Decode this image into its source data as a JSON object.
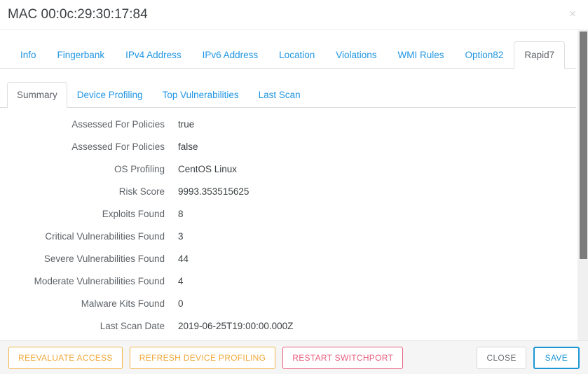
{
  "header": {
    "title": "MAC 00:0c:29:30:17:84",
    "close_icon": "close-icon",
    "close_glyph": "×"
  },
  "tabs_main": [
    {
      "label": "Info",
      "active": false
    },
    {
      "label": "Fingerbank",
      "active": false
    },
    {
      "label": "IPv4 Address",
      "active": false
    },
    {
      "label": "IPv6 Address",
      "active": false
    },
    {
      "label": "Location",
      "active": false
    },
    {
      "label": "Violations",
      "active": false
    },
    {
      "label": "WMI Rules",
      "active": false
    },
    {
      "label": "Option82",
      "active": false
    },
    {
      "label": "Rapid7",
      "active": true
    }
  ],
  "tabs_sub": [
    {
      "label": "Summary",
      "active": true
    },
    {
      "label": "Device Profiling",
      "active": false
    },
    {
      "label": "Top Vulnerabilities",
      "active": false
    },
    {
      "label": "Last Scan",
      "active": false
    }
  ],
  "details": [
    {
      "label": "Assessed For Policies",
      "value": "true"
    },
    {
      "label": "Assessed For Policies",
      "value": "false"
    },
    {
      "label": "OS Profiling",
      "value": "CentOS Linux"
    },
    {
      "label": "Risk Score",
      "value": "9993.353515625"
    },
    {
      "label": "Exploits Found",
      "value": "8"
    },
    {
      "label": "Critical Vulnerabilities Found",
      "value": "3"
    },
    {
      "label": "Severe Vulnerabilities Found",
      "value": "44"
    },
    {
      "label": "Moderate Vulnerabilities Found",
      "value": "4"
    },
    {
      "label": "Malware Kits Found",
      "value": "0"
    },
    {
      "label": "Last Scan Date",
      "value": "2019-06-25T19:00:00.000Z"
    }
  ],
  "footer": {
    "reevaluate_access": "REEVALUATE ACCESS",
    "refresh_device_profiling": "REFRESH DEVICE PROFILING",
    "restart_switchport": "RESTART SWITCHPORT",
    "close": "CLOSE",
    "save": "SAVE"
  },
  "colors": {
    "link": "#2196e3",
    "warn": "#f0a93c",
    "danger": "#e8607e",
    "primary": "#1d96d5",
    "text": "#3c4043",
    "label": "#5f6368"
  }
}
